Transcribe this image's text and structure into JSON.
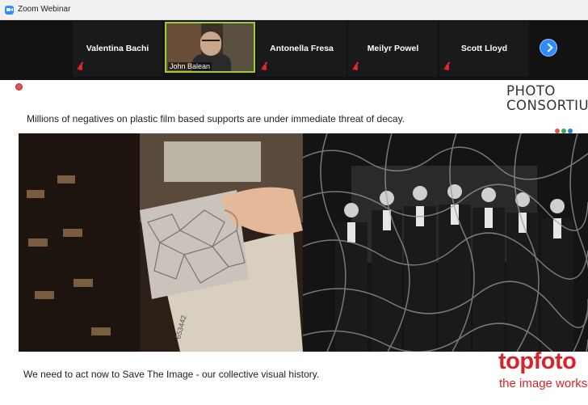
{
  "window": {
    "title": "Zoom Webinar"
  },
  "participants": [
    {
      "name": "Valentina Bachi",
      "muted": true
    },
    {
      "name": "John Balean",
      "video": true,
      "muted": false
    },
    {
      "name": "Antonella Fresa",
      "muted": true
    },
    {
      "name": "Meilyr Powel",
      "muted": true
    },
    {
      "name": "Scott Lloyd",
      "muted": true
    }
  ],
  "slide": {
    "top_text": "Millions of negatives on plastic film based supports are under immediate threat of decay.",
    "bottom_text": "We need to act now to Save The Image - our collective visual history.",
    "logo_photo": {
      "line1": "PHOTO",
      "line2": "CONSORTIUM",
      "dot_colors": [
        "#e8514d",
        "#3aaa55",
        "#2f7fd0"
      ]
    },
    "logo_topfoto": {
      "brand": "topfoto",
      "tagline": "the image works",
      "color": "#d8232a"
    },
    "left_image_label": "653442"
  },
  "icons": {
    "zoom_logo": "zoom-icon",
    "next": "chevron-right-icon",
    "mute": "muted-mic-icon",
    "record": "record-icon"
  }
}
